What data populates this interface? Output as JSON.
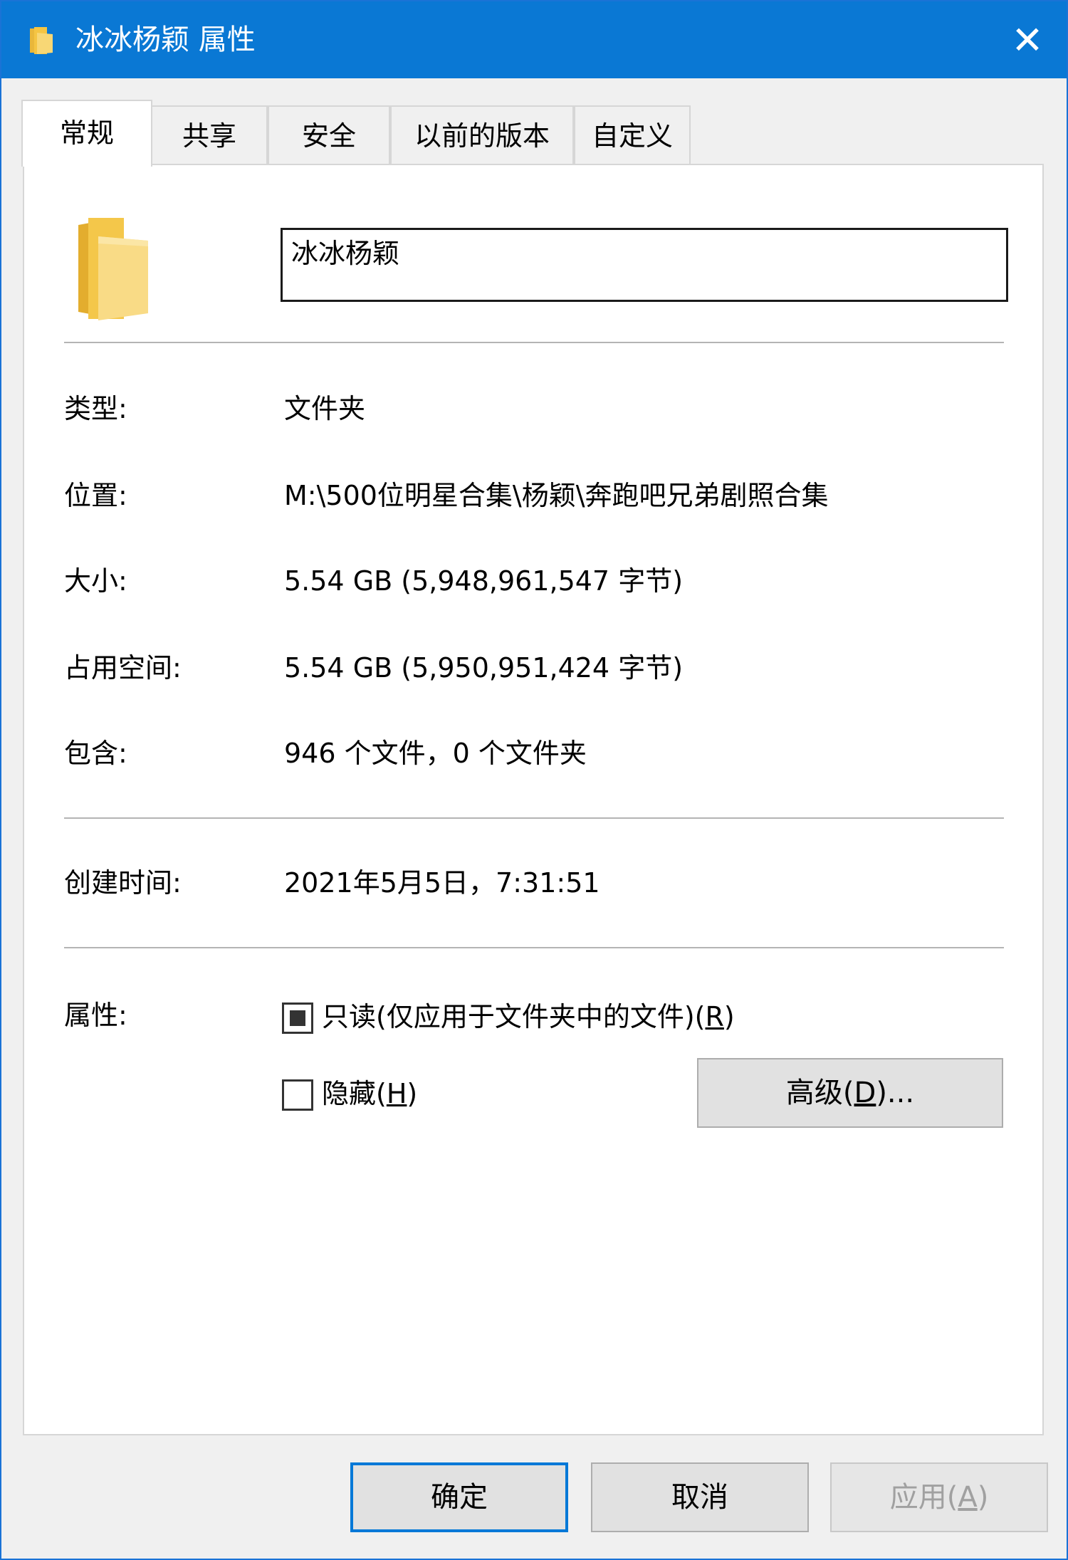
{
  "window": {
    "title": "冰冰杨颖 属性",
    "close_glyph": "✕"
  },
  "tabs": [
    {
      "label": "常规",
      "active": true
    },
    {
      "label": "共享",
      "active": false
    },
    {
      "label": "安全",
      "active": false
    },
    {
      "label": "以前的版本",
      "active": false
    },
    {
      "label": "自定义",
      "active": false
    }
  ],
  "general": {
    "folder_name": "冰冰杨颖",
    "type_label": "类型:",
    "type_value": "文件夹",
    "location_label": "位置:",
    "location_value": "M:\\500位明星合集\\杨颖\\奔跑吧兄弟剧照合集",
    "size_label": "大小:",
    "size_value": "5.54 GB (5,948,961,547 字节)",
    "disk_size_label": "占用空间:",
    "disk_size_value": "5.54 GB (5,950,951,424 字节)",
    "contains_label": "包含:",
    "contains_value": "946 个文件，0 个文件夹",
    "created_label": "创建时间:",
    "created_value": "2021年5月5日，7:31:51",
    "attributes_label": "属性:",
    "readonly_prefix": "只读(仅应用于文件夹中的文件)(",
    "readonly_key": "R",
    "readonly_suffix": ")",
    "hidden_prefix": "隐藏(",
    "hidden_key": "H",
    "hidden_suffix": ")",
    "advanced_prefix": "高级(",
    "advanced_key": "D",
    "advanced_suffix": ")..."
  },
  "buttons": {
    "ok": "确定",
    "cancel": "取消",
    "apply_prefix": "应用(",
    "apply_key": "A",
    "apply_suffix": ")"
  },
  "colors": {
    "titlebar": "#0a78d4",
    "folder_yellow": "#f5c543",
    "default_button_border": "#0078d7"
  },
  "icons": {
    "title": "folder-icon",
    "close": "close-icon",
    "main": "folder-icon"
  }
}
